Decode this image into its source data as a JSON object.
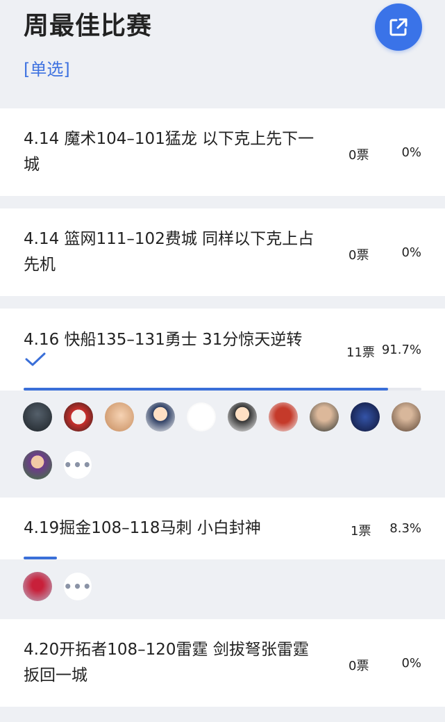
{
  "poll": {
    "title": "周最佳比赛",
    "type_label": "[单选]",
    "share_icon": "share-external-icon"
  },
  "options": [
    {
      "text": "4.14 魔术104–101猛龙 以下克上先下一城",
      "votes": "0票",
      "percent": "0%",
      "ratio": 0,
      "selected": false
    },
    {
      "text": "4.14 篮网111–102费城 同样以下克上占先机",
      "votes": "0票",
      "percent": "0%",
      "ratio": 0,
      "selected": false
    },
    {
      "text": "4.16 快船135–131勇士 31分惊天逆转",
      "votes": "11票",
      "percent": "91.7%",
      "ratio": 0.917,
      "selected": true
    },
    {
      "text": "4.19掘金108–118马刺 小白封神",
      "votes": "1票",
      "percent": "8.3%",
      "ratio": 0.083,
      "selected": false
    },
    {
      "text": "4.20开拓者108–120雷霆 剑拔弩张雷霆扳回一城",
      "votes": "0票",
      "percent": "0%",
      "ratio": 0,
      "selected": false
    }
  ],
  "voters": {
    "option3_count_shown": 11,
    "option4_count_shown": 1,
    "more_label": "•••"
  },
  "colors": {
    "accent": "#3a73e8",
    "bar": "#3a6fd8",
    "background": "#eef0f4"
  }
}
